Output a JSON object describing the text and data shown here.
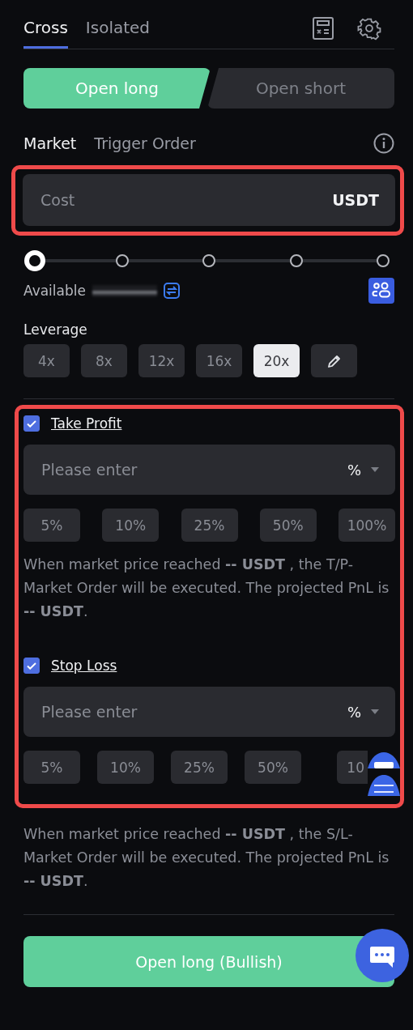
{
  "margin_tabs": [
    {
      "label": "Cross",
      "selected": true
    },
    {
      "label": "Isolated",
      "selected": false
    }
  ],
  "side_buttons": [
    {
      "label": "Open long",
      "selected": true
    },
    {
      "label": "Open short",
      "selected": false
    }
  ],
  "order_types": [
    {
      "label": "Market",
      "selected": true
    },
    {
      "label": "Trigger Order",
      "selected": false
    }
  ],
  "cost_field": {
    "placeholder": "Cost",
    "unit": "USDT",
    "highlighted": true
  },
  "size_slider": {
    "level": 0
  },
  "available": {
    "label": "Available"
  },
  "leverage": {
    "label": "Leverage",
    "options": [
      {
        "label": "4x",
        "selected": false
      },
      {
        "label": "8x",
        "selected": false
      },
      {
        "label": "12x",
        "selected": false
      },
      {
        "label": "16x",
        "selected": false
      },
      {
        "label": "20x",
        "selected": true
      }
    ]
  },
  "tp_sl_highlighted": true,
  "orders": [
    {
      "label": "Take Profit",
      "checked": true,
      "placeholder": "Please enter",
      "unit": "%",
      "presets": [
        "5%",
        "10%",
        "25%",
        "50%",
        "100%"
      ],
      "note": "When market price reached  **-- USDT** , the T/P-Market Order will be executed. The projected PnL is **-- USDT**."
    },
    {
      "label": "Stop Loss",
      "checked": true,
      "placeholder": "Please enter",
      "unit": "%",
      "presets": [
        "5%",
        "10%",
        "25%",
        "50%",
        "10"
      ],
      "note": "When market price reached  **-- USDT** , the S/L-Market Order will be executed. The projected PnL is **-- USDT**."
    }
  ],
  "submit_button": {
    "label": "Open long (Bullish)"
  }
}
